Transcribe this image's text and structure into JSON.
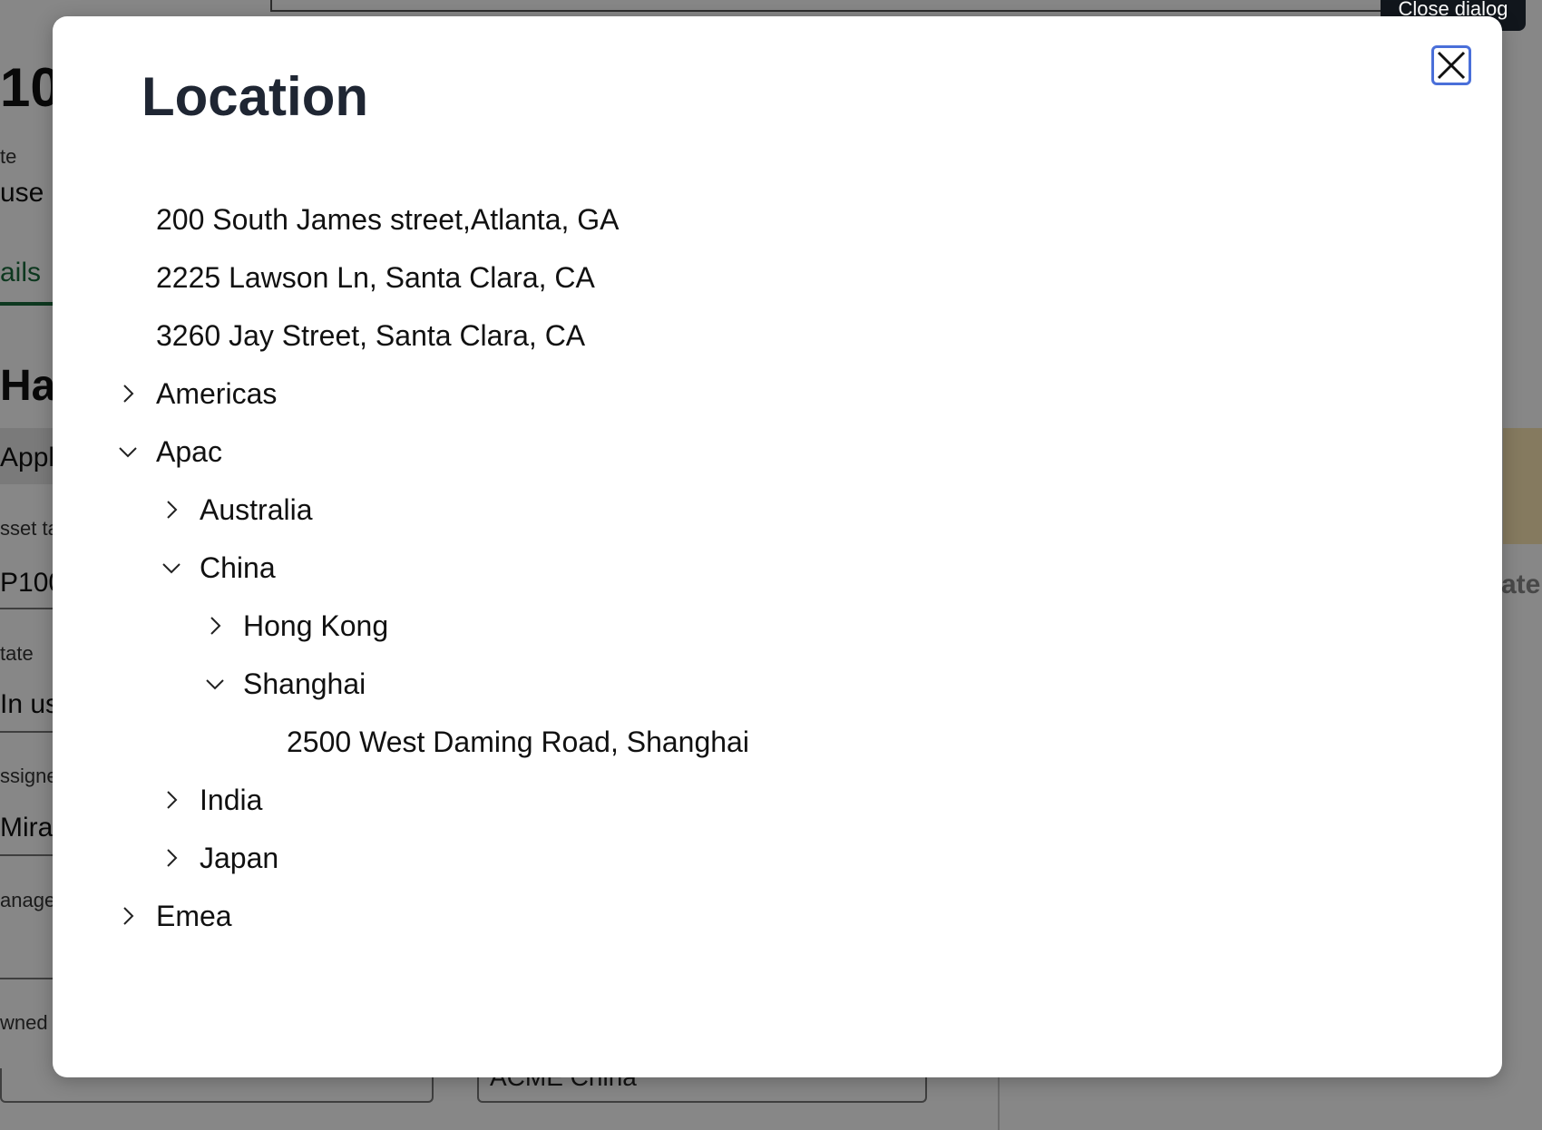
{
  "background": {
    "number": "10",
    "label_1": "te",
    "value_1": "use",
    "tab": "ails",
    "heading": "Har",
    "app_field": "Appl",
    "label_asset": "sset ta",
    "value_asset": "P100",
    "label_state": "tate",
    "value_state": "In us",
    "label_assigned": "ssigne",
    "value_assigned": "Mira",
    "label_managed": "anage",
    "label_owned": "wned",
    "right_label": "ate",
    "bottom_value": "ACME China"
  },
  "tooltip": {
    "text": "Close dialog"
  },
  "dialog": {
    "title": "Location",
    "close_label": "Close dialog",
    "tree": [
      {
        "label": "200 South James street,Atlanta, GA",
        "level": 0,
        "state": "leaf"
      },
      {
        "label": "2225 Lawson Ln, Santa Clara, CA",
        "level": 0,
        "state": "leaf"
      },
      {
        "label": "3260 Jay Street, Santa Clara, CA",
        "level": 0,
        "state": "leaf"
      },
      {
        "label": "Americas",
        "level": 0,
        "state": "collapsed"
      },
      {
        "label": "Apac",
        "level": 0,
        "state": "expanded"
      },
      {
        "label": "Australia",
        "level": 1,
        "state": "collapsed"
      },
      {
        "label": "China",
        "level": 1,
        "state": "expanded"
      },
      {
        "label": "Hong Kong",
        "level": 2,
        "state": "collapsed"
      },
      {
        "label": "Shanghai",
        "level": 2,
        "state": "expanded"
      },
      {
        "label": "2500 West Daming Road, Shanghai",
        "level": 3,
        "state": "leaf"
      },
      {
        "label": "India",
        "level": 1,
        "state": "collapsed"
      },
      {
        "label": "Japan",
        "level": 1,
        "state": "collapsed"
      },
      {
        "label": "Emea",
        "level": 0,
        "state": "collapsed"
      }
    ]
  },
  "colors": {
    "title": "#1f2633",
    "close_border": "#4a6fd9",
    "tooltip_bg": "#11161c"
  }
}
